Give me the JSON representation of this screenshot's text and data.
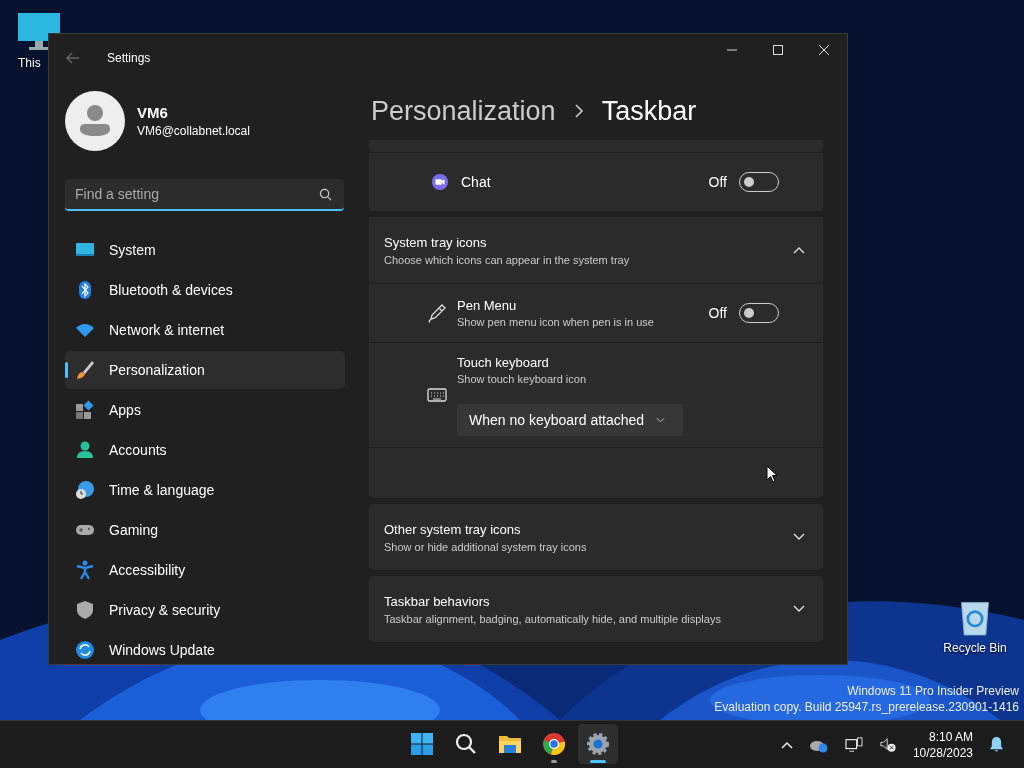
{
  "desktop": {
    "icons": [
      {
        "kind": "pc",
        "label": "This"
      },
      {
        "kind": "bin",
        "label": "Recycle Bin"
      }
    ],
    "watermark": [
      "Windows 11 Pro Insider Preview",
      "Evaluation copy. Build 25947.rs_prerelease.230901-1416"
    ]
  },
  "window": {
    "title": "Settings",
    "user": {
      "name": "VM6",
      "email": "VM6@collabnet.local"
    },
    "search": {
      "placeholder": "Find a setting"
    },
    "nav": [
      {
        "label": "System",
        "selected": false
      },
      {
        "label": "Bluetooth & devices",
        "selected": false
      },
      {
        "label": "Network & internet",
        "selected": false
      },
      {
        "label": "Personalization",
        "selected": true
      },
      {
        "label": "Apps",
        "selected": false
      },
      {
        "label": "Accounts",
        "selected": false
      },
      {
        "label": "Time & language",
        "selected": false
      },
      {
        "label": "Gaming",
        "selected": false
      },
      {
        "label": "Accessibility",
        "selected": false
      },
      {
        "label": "Privacy & security",
        "selected": false
      },
      {
        "label": "Windows Update",
        "selected": false
      }
    ]
  },
  "settings_pane": {
    "header": {
      "parent": "Personalization",
      "current": "Taskbar"
    },
    "cards": [
      {
        "kind": "toggle",
        "label": "Chat",
        "state_text": "Off",
        "on": false
      },
      {
        "kind": "expander",
        "title": "System tray icons",
        "description": "Choose which icons can appear in the system tray",
        "expanded": true,
        "children": [
          {
            "kind": "toggle",
            "label": "Pen Menu",
            "description": "Show pen menu icon when pen is in use",
            "state_text": "Off",
            "on": false
          },
          {
            "kind": "dropdown",
            "label": "Touch keyboard",
            "description": "Show touch keyboard icon",
            "value": "When no keyboard attached"
          }
        ]
      },
      {
        "kind": "expander",
        "title": "Other system tray icons",
        "description": "Show or hide additional system tray icons",
        "expanded": false
      },
      {
        "kind": "expander",
        "title": "Taskbar behaviors",
        "description": "Taskbar alignment, badging, automatically hide, and multiple displays",
        "expanded": false
      }
    ]
  },
  "taskbar": {
    "apps": [
      {
        "kind": "start",
        "selected": false,
        "running": false
      },
      {
        "kind": "search",
        "selected": false,
        "running": false
      },
      {
        "kind": "explorer",
        "selected": false,
        "running": false
      },
      {
        "kind": "chrome",
        "selected": false,
        "running": true
      },
      {
        "kind": "settings",
        "selected": true,
        "running": true
      }
    ],
    "time": "8:10 AM",
    "date": "10/28/2023"
  }
}
